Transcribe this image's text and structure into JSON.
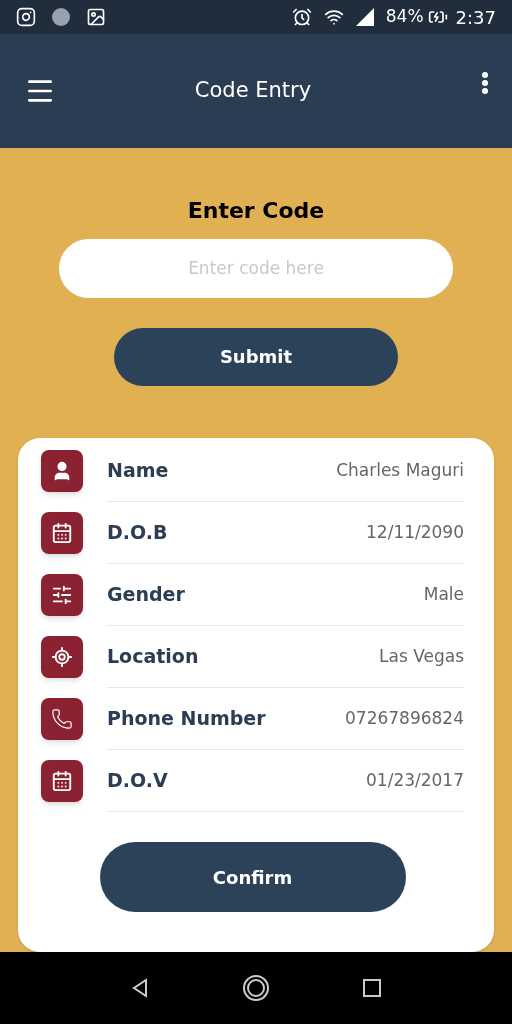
{
  "status_bar": {
    "battery": "84%",
    "time": "2:37"
  },
  "app_bar": {
    "title": "Code Entry"
  },
  "code_form": {
    "heading": "Enter Code",
    "placeholder": "Enter code here",
    "submit": "Submit"
  },
  "details": [
    {
      "kind": "person",
      "label": "Name",
      "value": "Charles Maguri"
    },
    {
      "kind": "calendar",
      "label": "D.O.B",
      "value": "12/11/2090"
    },
    {
      "kind": "sliders",
      "label": "Gender",
      "value": "Male"
    },
    {
      "kind": "location",
      "label": "Location",
      "value": "Las Vegas"
    },
    {
      "kind": "phone",
      "label": "Phone Number",
      "value": "07267896824"
    },
    {
      "kind": "calendar",
      "label": "D.O.V",
      "value": "01/23/2017"
    }
  ],
  "confirm": "Confirm"
}
